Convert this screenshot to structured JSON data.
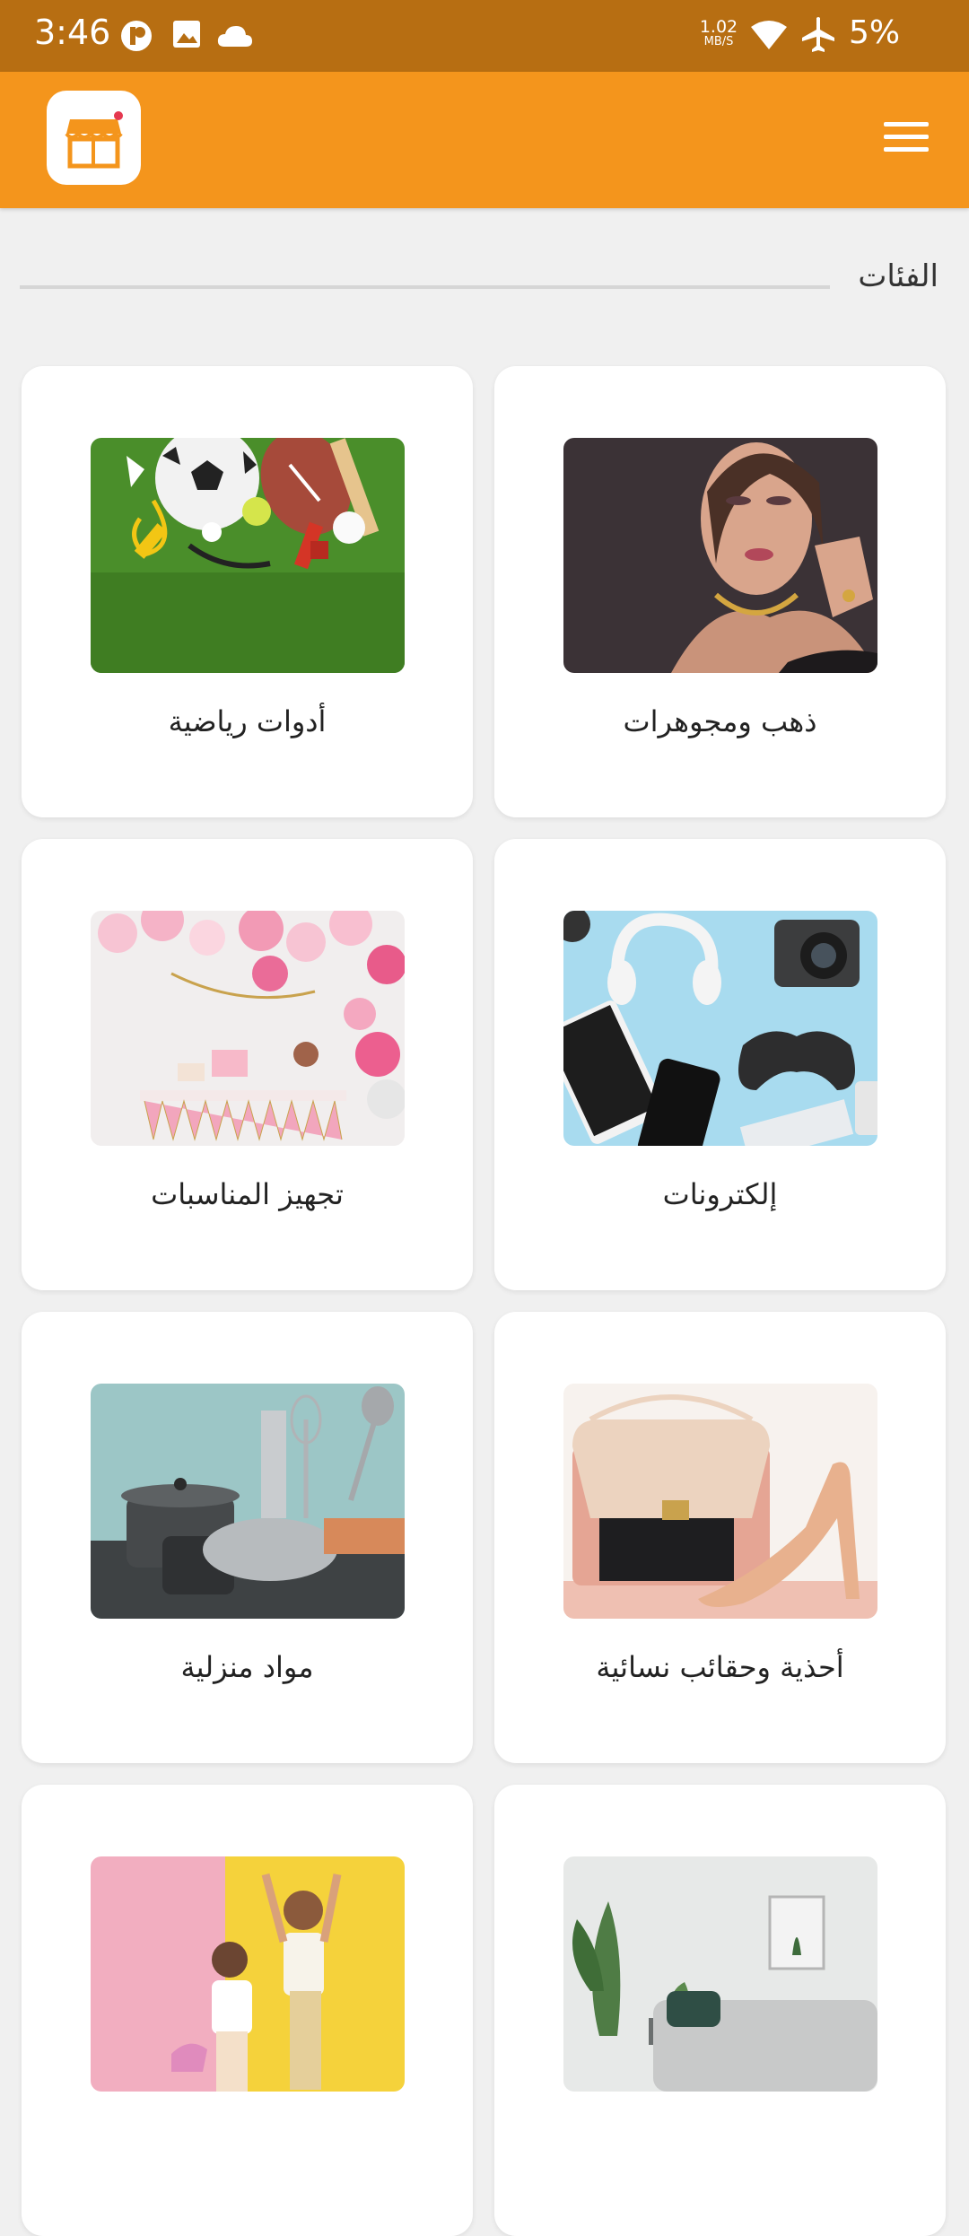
{
  "status_bar": {
    "time": "3:46",
    "net_speed": "1.02",
    "net_unit": "MB/S",
    "battery": "5%",
    "icons": [
      "app-icon",
      "image-icon",
      "cloud-icon",
      "wifi-icon",
      "airplane-icon"
    ]
  },
  "app_bar": {
    "logo_icon": "store-icon",
    "menu_icon": "hamburger-menu-icon",
    "bg_color": "#f4951c"
  },
  "section": {
    "title": "الفئات"
  },
  "categories": [
    {
      "label": "ذهب ومجوهرات",
      "image": "jewelry-woman-photo"
    },
    {
      "label": "أدوات رياضية",
      "image": "sports-equipment-photo"
    },
    {
      "label": "إلكترونات",
      "image": "electronics-photo"
    },
    {
      "label": "تجهيز المناسبات",
      "image": "party-decor-photo"
    },
    {
      "label": "أحذية وحقائب نسائية",
      "image": "shoes-bag-photo"
    },
    {
      "label": "مواد منزلية",
      "image": "kitchenware-photo"
    },
    {
      "label": "",
      "image": "living-room-photo"
    },
    {
      "label": "",
      "image": "kids-photo"
    }
  ]
}
